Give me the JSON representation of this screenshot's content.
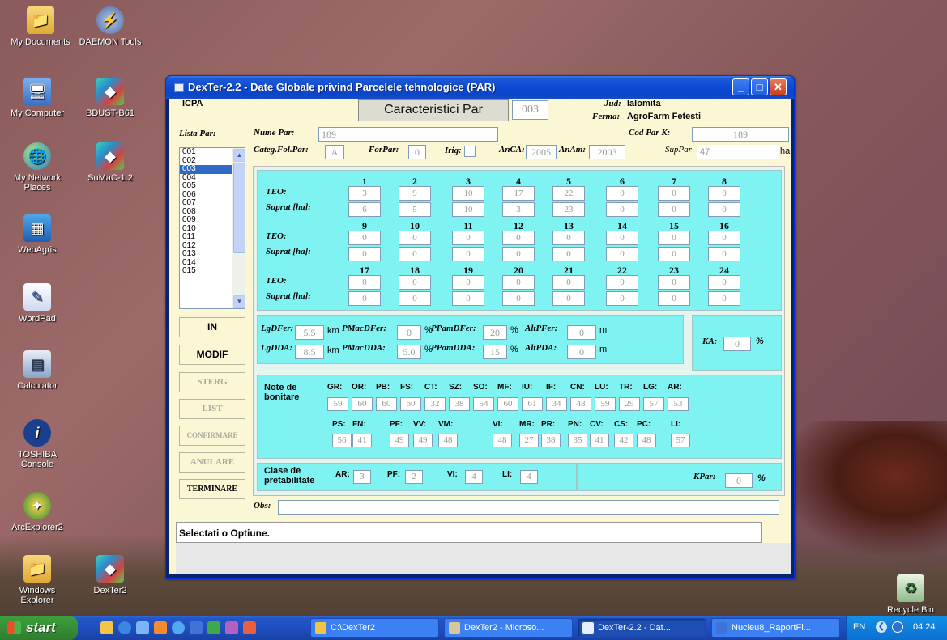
{
  "desktop": {
    "icons": [
      {
        "label": "My Documents",
        "glyph": "📁"
      },
      {
        "label": "DAEMON Tools",
        "glyph": "⚡"
      },
      {
        "label": "My Computer",
        "glyph": "🖥"
      },
      {
        "label": "BDUST-B61",
        "glyph": "◆"
      },
      {
        "label": "My Network Places",
        "glyph": "🌐"
      },
      {
        "label": "SuMaC-1.2",
        "glyph": "◆"
      },
      {
        "label": "WebAgris",
        "glyph": "▦"
      },
      {
        "label": "WordPad",
        "glyph": "✎"
      },
      {
        "label": "Calculator",
        "glyph": "▤"
      },
      {
        "label": "TOSHIBA Console",
        "glyph": "i"
      },
      {
        "label": "ArcExplorer2",
        "glyph": "✦"
      },
      {
        "label": "Windows Explorer",
        "glyph": "📁"
      },
      {
        "label": "DexTer2",
        "glyph": "◆"
      },
      {
        "label": "Recycle Bin",
        "glyph": "♻"
      }
    ]
  },
  "window": {
    "title": "DexTer-2.2  -  Date Globale privind Parcelele tehnologice (PAR)",
    "controls": {
      "minimize": "_",
      "maximize": "□",
      "close": "✕"
    }
  },
  "header": {
    "org": "ICPA",
    "section_title": "Caracteristici Par",
    "section_code": "003",
    "jud_label": "Jud:",
    "jud_value": "Ialomita",
    "ferma_label": "Ferma:",
    "ferma_value": "AgroFarm Fetesti"
  },
  "form": {
    "lista_par_label": "Lista Par:",
    "nume_par_label": "Nume Par:",
    "nume_par_value": "189",
    "cod_par_label": "Cod Par K:",
    "cod_par_value": "189",
    "categ_label": "Categ.Fol.Par:",
    "categ_value": "A",
    "forpar_label": "ForPar:",
    "forpar_value": "0",
    "irig_label": "Irig:",
    "anca_label": "AnCA:",
    "anca_value": "2005",
    "anam_label": "AnAm:",
    "anam_value": "2003",
    "suppar_label": "SupPar",
    "suppar_value": "47",
    "suppar_unit": "ha"
  },
  "parcel_list": [
    "001",
    "002",
    "003",
    "004",
    "005",
    "006",
    "007",
    "008",
    "009",
    "010",
    "011",
    "012",
    "013",
    "014",
    "015"
  ],
  "selected_parcel": "003",
  "buttons": {
    "in": "IN",
    "modif": "MODIF",
    "sterg": "STERG",
    "list": "LIST",
    "confirmare": "CONFIRMARE",
    "anulare": "ANULARE",
    "terminare": "TERMINARE"
  },
  "teo": {
    "teo_label": "TEO:",
    "suprat_label": "Suprat [ha]:",
    "rows": [
      {
        "nums": [
          "1",
          "2",
          "3",
          "4",
          "5",
          "6",
          "7",
          "8"
        ],
        "teo": [
          "3",
          "9",
          "10",
          "17",
          "22",
          "0",
          "0",
          "0"
        ],
        "suprat": [
          "6",
          "5",
          "10",
          "3",
          "23",
          "0",
          "0",
          "0"
        ]
      },
      {
        "nums": [
          "9",
          "10",
          "11",
          "12",
          "13",
          "14",
          "15",
          "16"
        ],
        "teo": [
          "0",
          "0",
          "0",
          "0",
          "0",
          "0",
          "0",
          "0"
        ],
        "suprat": [
          "0",
          "0",
          "0",
          "0",
          "0",
          "0",
          "0",
          "0"
        ]
      },
      {
        "nums": [
          "17",
          "18",
          "19",
          "20",
          "21",
          "22",
          "23",
          "24"
        ],
        "teo": [
          "0",
          "0",
          "0",
          "0",
          "0",
          "0",
          "0",
          "0"
        ],
        "suprat": [
          "0",
          "0",
          "0",
          "0",
          "0",
          "0",
          "0",
          "0"
        ]
      }
    ]
  },
  "distances": {
    "lgdfer_label": "LgDFer:",
    "lgdfer_value": "5.5",
    "km1": "km",
    "pmacdfer_label": "PMacDFer:",
    "pmacdfer_value": "0",
    "pct1": "%",
    "ppamdfer_label": "PPamDFer:",
    "ppamdfer_value": "20",
    "pct2": "%",
    "altpfer_label": "AltPFer:",
    "altpfer_value": "0",
    "m1": "m",
    "lgdda_label": "LgDDA:",
    "lgdda_value": "8.5",
    "km2": "km",
    "pmacdda_label": "PMacDDA:",
    "pmacdda_value": "5.0",
    "pct3": "%",
    "ppamdda_label": "PPamDDA:",
    "ppamdda_value": "15",
    "pct4": "%",
    "altpda_label": "AltPDA:",
    "altpda_value": "0",
    "m2": "m",
    "ka_label": "KA:",
    "ka_value": "0",
    "ka_unit": "%"
  },
  "note_bonitare": {
    "label": "Note de bonitare",
    "row1": [
      {
        "k": "GR:",
        "v": "59"
      },
      {
        "k": "OR:",
        "v": "60"
      },
      {
        "k": "PB:",
        "v": "60"
      },
      {
        "k": "FS:",
        "v": "60"
      },
      {
        "k": "CT:",
        "v": "32"
      },
      {
        "k": "SZ:",
        "v": "38"
      },
      {
        "k": "SO:",
        "v": "54"
      },
      {
        "k": "MF:",
        "v": "60"
      },
      {
        "k": "IU:",
        "v": "61"
      },
      {
        "k": "IF:",
        "v": "34"
      },
      {
        "k": "CN:",
        "v": "48"
      },
      {
        "k": "LU:",
        "v": "59"
      },
      {
        "k": "TR:",
        "v": "29"
      },
      {
        "k": "LG:",
        "v": "57"
      },
      {
        "k": "AR:",
        "v": "53"
      }
    ],
    "row2": [
      {
        "k": "PS:",
        "v": "56"
      },
      {
        "k": "FN:",
        "v": "41"
      },
      {
        "k": "PF:",
        "v": "49"
      },
      {
        "k": "VV:",
        "v": "49"
      },
      {
        "k": "VM:",
        "v": "48"
      },
      {
        "k": "VI:",
        "v": "48"
      },
      {
        "k": "MR:",
        "v": "27"
      },
      {
        "k": "PR:",
        "v": "38"
      },
      {
        "k": "PN:",
        "v": "35"
      },
      {
        "k": "CV:",
        "v": "41"
      },
      {
        "k": "CS:",
        "v": "42"
      },
      {
        "k": "PC:",
        "v": "48"
      },
      {
        "k": "LI:",
        "v": "57"
      }
    ]
  },
  "clase": {
    "label": "Clase de pretabilitate",
    "items": [
      {
        "k": "AR:",
        "v": "3"
      },
      {
        "k": "PF:",
        "v": "2"
      },
      {
        "k": "VI:",
        "v": "4"
      },
      {
        "k": "LI:",
        "v": "4"
      }
    ],
    "kpar_label": "KPar:",
    "kpar_value": "0",
    "kpar_unit": "%"
  },
  "obs_label": "Obs:",
  "obs_value": "",
  "status_text": "Selectati o Optiune.",
  "taskbar": {
    "start": "start",
    "tasks": [
      "C:\\DexTer2",
      "DexTer2 - Microso...",
      "DexTer-2.2 - Dat...",
      "Nucleu8_RaportFi..."
    ],
    "lang": "EN",
    "clock": "04:24"
  }
}
